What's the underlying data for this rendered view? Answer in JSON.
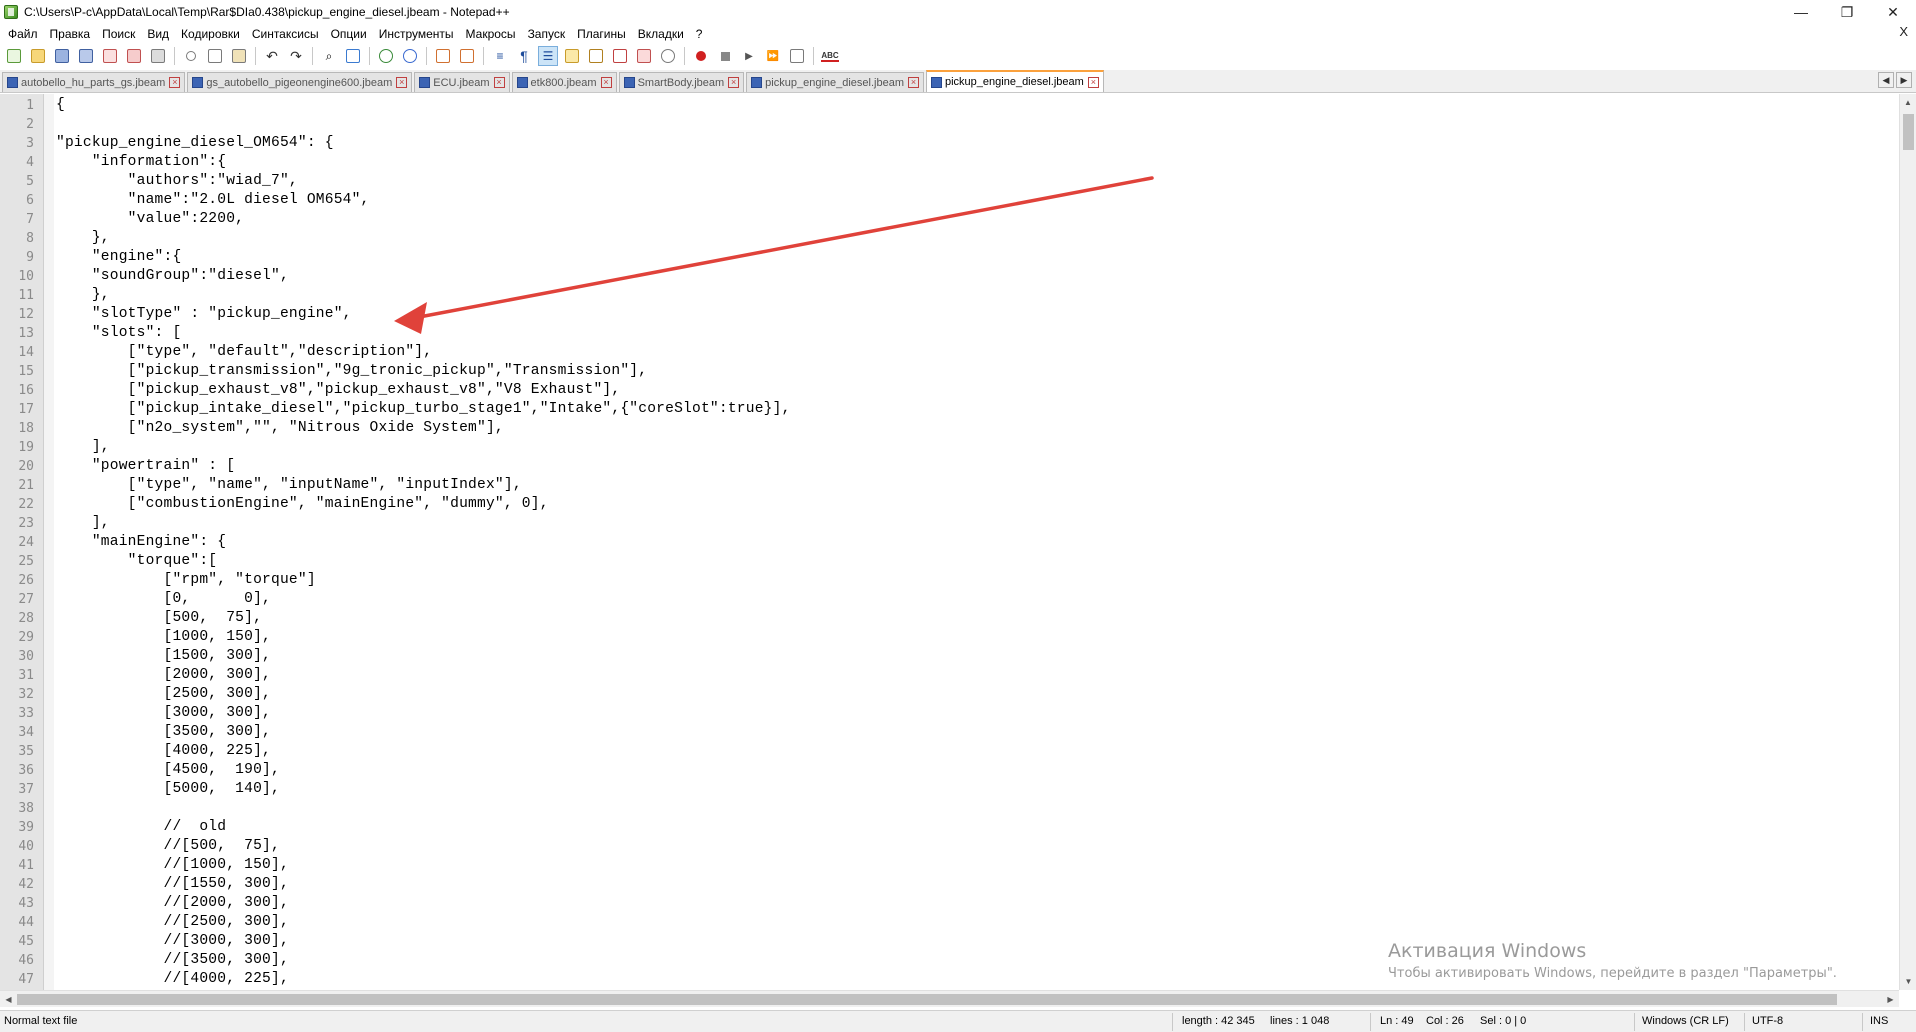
{
  "window": {
    "title": "C:\\Users\\P-c\\AppData\\Local\\Temp\\Rar$DIa0.438\\pickup_engine_diesel.jbeam - Notepad++",
    "minimize": "—",
    "maximize": "❐",
    "close": "✕"
  },
  "menu": {
    "items": [
      "Файл",
      "Правка",
      "Поиск",
      "Вид",
      "Кодировки",
      "Синтаксисы",
      "Опции",
      "Инструменты",
      "Макросы",
      "Запуск",
      "Плагины",
      "Вкладки",
      "?"
    ],
    "close_doc": "X"
  },
  "tabs": [
    {
      "label": "autobello_hu_parts_gs.jbeam",
      "active": false
    },
    {
      "label": "gs_autobello_pigeonengine600.jbeam",
      "active": false
    },
    {
      "label": "ECU.jbeam",
      "active": false
    },
    {
      "label": "etk800.jbeam",
      "active": false
    },
    {
      "label": "SmartBody.jbeam",
      "active": false
    },
    {
      "label": "pickup_engine_diesel.jbeam",
      "active": false
    },
    {
      "label": "pickup_engine_diesel.jbeam",
      "active": true
    }
  ],
  "editor": {
    "lines": [
      "{",
      "",
      "\"pickup_engine_diesel_OM654\": {",
      "    \"information\":{",
      "        \"authors\":\"wiad_7\",",
      "        \"name\":\"2.0L diesel OM654\",",
      "        \"value\":2200,",
      "    },",
      "    \"engine\":{",
      "    \"soundGroup\":\"diesel\",",
      "    },",
      "    \"slotType\" : \"pickup_engine\",",
      "    \"slots\": [",
      "        [\"type\", \"default\",\"description\"],",
      "        [\"pickup_transmission\",\"9g_tronic_pickup\",\"Transmission\"],",
      "        [\"pickup_exhaust_v8\",\"pickup_exhaust_v8\",\"V8 Exhaust\"],",
      "        [\"pickup_intake_diesel\",\"pickup_turbo_stage1\",\"Intake\",{\"coreSlot\":true}],",
      "        [\"n2o_system\",\"\", \"Nitrous Oxide System\"],",
      "    ],",
      "    \"powertrain\" : [",
      "        [\"type\", \"name\", \"inputName\", \"inputIndex\"],",
      "        [\"combustionEngine\", \"mainEngine\", \"dummy\", 0],",
      "    ],",
      "    \"mainEngine\": {",
      "        \"torque\":[",
      "            [\"rpm\", \"torque\"]",
      "            [0,      0],",
      "            [500,  75],",
      "            [1000, 150],",
      "            [1500, 300],",
      "            [2000, 300],",
      "            [2500, 300],",
      "            [3000, 300],",
      "            [3500, 300],",
      "            [4000, 225],",
      "            [4500,  190],",
      "            [5000,  140],",
      "",
      "            //  old",
      "            //[500,  75],",
      "            //[1000, 150],",
      "            //[1550, 300],",
      "            //[2000, 300],",
      "            //[2500, 300],",
      "            //[3000, 300],",
      "            //[3500, 300],",
      "            //[4000, 225],"
    ]
  },
  "status": {
    "file_type": "Normal text file",
    "length": "length : 42 345",
    "lines": "lines : 1 048",
    "ln": "Ln : 49",
    "col": "Col : 26",
    "sel": "Sel : 0 | 0",
    "eol": "Windows (CR LF)",
    "encoding": "UTF-8",
    "mode": "INS"
  },
  "watermark": {
    "title": "Активация Windows",
    "subtitle": "Чтобы активировать Windows, перейдите в раздел \"Параметры\"."
  },
  "colors": {
    "annotation_arrow": "#e0423a",
    "active_tab_accent": "#fba13d",
    "gutter": "#e4e4e4"
  }
}
